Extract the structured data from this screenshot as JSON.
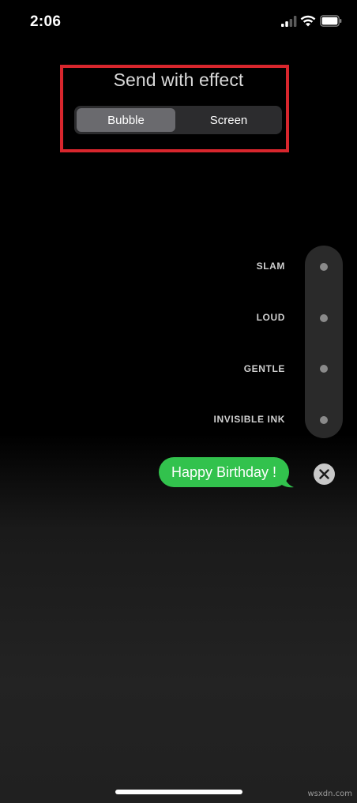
{
  "status_bar": {
    "time": "2:06",
    "icons": [
      "cellular-signal-icon",
      "wifi-icon",
      "battery-icon"
    ]
  },
  "effect_picker": {
    "title": "Send with effect",
    "tabs": [
      {
        "label": "Bubble",
        "selected": true
      },
      {
        "label": "Screen",
        "selected": false
      }
    ],
    "highlight_color": "#d8262d"
  },
  "bubble_effects": [
    {
      "label": "SLAM"
    },
    {
      "label": "LOUD"
    },
    {
      "label": "GENTLE"
    },
    {
      "label": "INVISIBLE INK"
    }
  ],
  "message": {
    "text": "Happy Birthday !",
    "bubble_color": "#32c24d"
  },
  "cancel": {
    "icon": "close-icon"
  },
  "watermark": "wsxdn.com"
}
